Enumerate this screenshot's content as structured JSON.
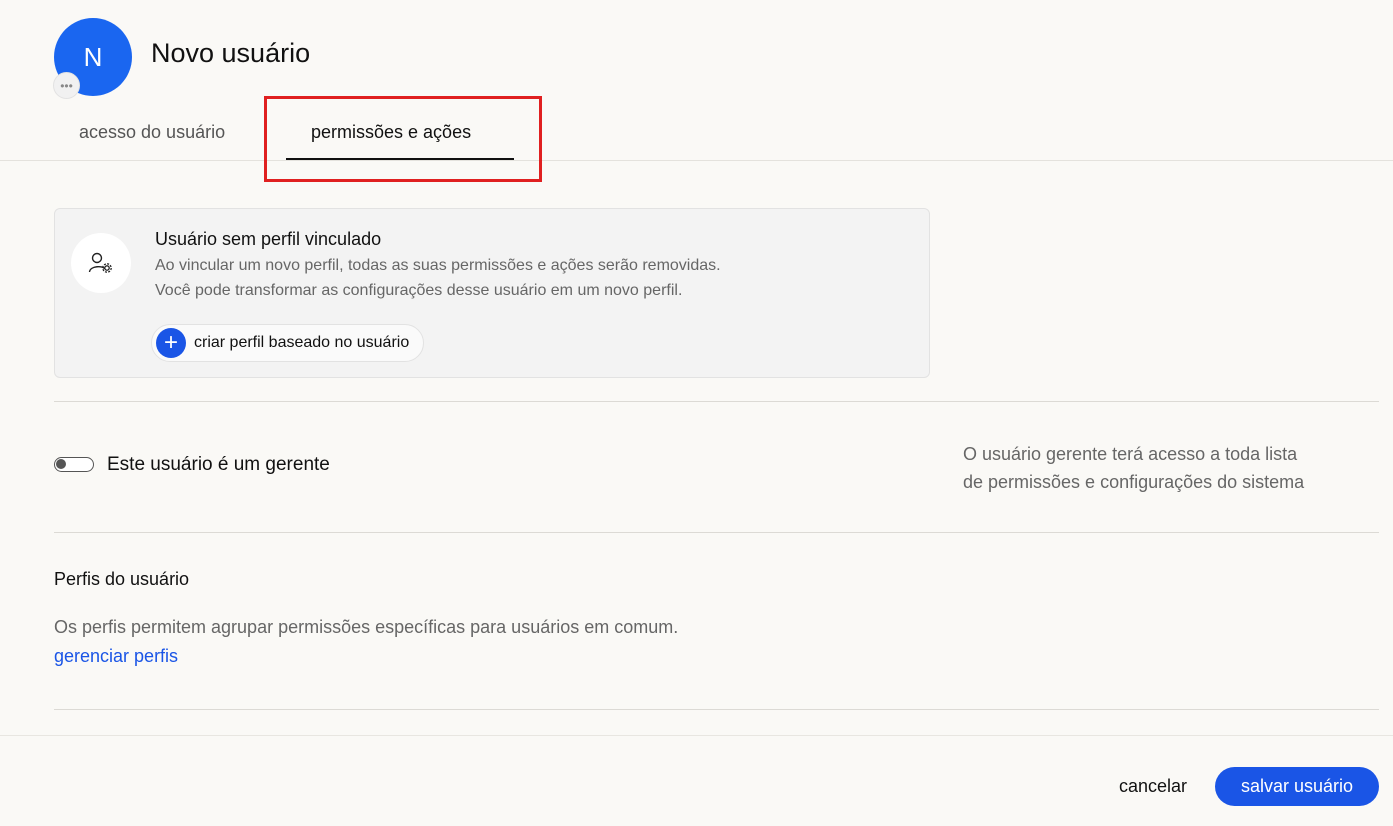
{
  "header": {
    "avatar_initial": "N",
    "avatar_menu_icon": "more-horizontal-icon",
    "title": "Novo usuário"
  },
  "tabs": [
    {
      "label": "acesso do usuário",
      "active": false
    },
    {
      "label": "permissões e ações",
      "active": true
    }
  ],
  "profile_card": {
    "icon": "user-settings-icon",
    "title": "Usuário sem perfil vinculado",
    "line1": "Ao vincular um novo perfil, todas as suas permissões e ações serão removidas.",
    "line2": "Você pode transformar as configurações desse usuário em um novo perfil.",
    "create_button_label": "criar perfil baseado no usuário",
    "create_button_icon": "plus-icon"
  },
  "manager": {
    "toggle_label": "Este usuário é um gerente",
    "toggle_on": false,
    "info_line1": "O usuário gerente terá acesso a toda lista",
    "info_line2": "de permissões e configurações do sistema"
  },
  "profiles": {
    "title": "Perfis do usuário",
    "description": "Os perfis permitem agrupar permissões específicas para usuários em comum.",
    "link_label": "gerenciar perfis"
  },
  "footer": {
    "cancel_label": "cancelar",
    "save_label": "salvar usuário"
  },
  "colors": {
    "accent": "#1a55e6",
    "avatar": "#1a66f0",
    "highlight": "#e02020"
  }
}
